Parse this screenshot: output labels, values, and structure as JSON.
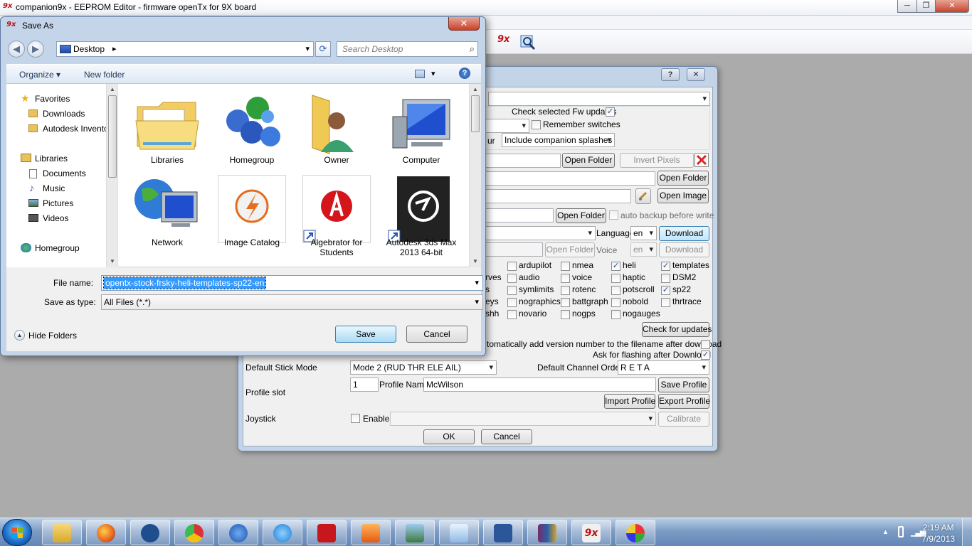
{
  "app": {
    "logo_text": "9x",
    "title": "companion9x - EEPROM Editor - firmware openTx for 9X board",
    "min_label": "─",
    "max_label": "❐",
    "close_label": "✕"
  },
  "preferences": {
    "help_label": "?",
    "close_label": "✕",
    "check_fw_updates_label": "Check selected Fw updates",
    "check_fw_updates_checked": true,
    "remember_switches_label": "Remember switches",
    "remember_switches_checked": false,
    "splash_label_tail": "ur",
    "splash_option": "Include companion splashes",
    "open_folder_label": "Open Folder",
    "invert_pixels_label": "Invert Pixels",
    "open_image_label": "Open Image",
    "auto_backup_label": "auto backup before write",
    "language_label": "Language",
    "language_value": "en",
    "download_label": "Download",
    "voice_label": "Voice",
    "voice_value": "en",
    "options": [
      {
        "label": "rves",
        "checked": null
      },
      {
        "label": "s",
        "checked": null
      },
      {
        "label": "eys",
        "checked": null
      },
      {
        "label": "shh",
        "checked": null
      },
      {
        "label": "ardupilot",
        "checked": false
      },
      {
        "label": "audio",
        "checked": false
      },
      {
        "label": "symlimits",
        "checked": false
      },
      {
        "label": "nographics",
        "checked": false
      },
      {
        "label": "novario",
        "checked": false
      },
      {
        "label": "nmea",
        "checked": false
      },
      {
        "label": "voice",
        "checked": false
      },
      {
        "label": "rotenc",
        "checked": false
      },
      {
        "label": "battgraph",
        "checked": false
      },
      {
        "label": "nogps",
        "checked": false
      },
      {
        "label": "heli",
        "checked": true
      },
      {
        "label": "haptic",
        "checked": false
      },
      {
        "label": "potscroll",
        "checked": false
      },
      {
        "label": "nobold",
        "checked": false
      },
      {
        "label": "nogauges",
        "checked": false
      },
      {
        "label": "templates",
        "checked": true
      },
      {
        "label": "DSM2",
        "checked": false
      },
      {
        "label": "sp22",
        "checked": true
      },
      {
        "label": "thrtrace",
        "checked": false
      }
    ],
    "check_updates_label": "Check for updates",
    "auto_version_label": "tomatically add version number to the filename after download",
    "ask_flashing_label": "Ask for flashing after Download",
    "ask_flashing_checked": true,
    "default_stick_mode_label": "Default Stick Mode",
    "stick_mode_value": "Mode 2 (RUD THR ELE AIL)",
    "default_channel_order_label": "Default Channel Order",
    "channel_order_value": "R E T A",
    "profile_slot_label": "Profile slot",
    "profile_slot_value": "1",
    "profile_name_label": "Profile Name",
    "profile_name_value": "McWilson",
    "save_profile_label": "Save Profile",
    "import_profile_label": "Import Profile",
    "export_profile_label": "Export Profile",
    "joystick_label": "Joystick",
    "enable_label": "Enable",
    "calibrate_label": "Calibrate",
    "ok_label": "OK",
    "cancel_label": "Cancel"
  },
  "save_dialog": {
    "logo_text": "9x",
    "title": "Save As",
    "close_label": "✕",
    "address": "Desktop",
    "address_arrow": "▸",
    "search_placeholder": "Search Desktop",
    "organize_label": "Organize ▾",
    "new_folder_label": "New folder",
    "help_label": "?",
    "nav": {
      "favorites": "Favorites",
      "downloads": "Downloads",
      "autodesk": "Autodesk Invento",
      "libraries": "Libraries",
      "documents": "Documents",
      "music": "Music",
      "pictures": "Pictures",
      "videos": "Videos",
      "homegroup": "Homegroup"
    },
    "items": [
      {
        "label": "Libraries"
      },
      {
        "label": "Homegroup"
      },
      {
        "label": "Owner"
      },
      {
        "label": "Computer"
      },
      {
        "label": "Network"
      },
      {
        "label": "Image Catalog"
      },
      {
        "label": "Algebrator for Students"
      },
      {
        "label": "Autodesk 3ds Max 2013 64-bit"
      }
    ],
    "file_name_label": "File name:",
    "file_name_value": "opentx-stock-frsky-heli-templates-sp22-en",
    "save_type_label": "Save as type:",
    "save_type_value": "All Files (*.*)",
    "hide_folders_label": "Hide Folders",
    "save_label": "Save",
    "cancel_label": "Cancel"
  },
  "taskbar": {
    "time": "2:19 AM",
    "date": "7/9/2013"
  },
  "colors": {
    "selection": "#3399ff",
    "taskbar": "#6487b6",
    "dialog_frame": "#c4d5ea"
  }
}
